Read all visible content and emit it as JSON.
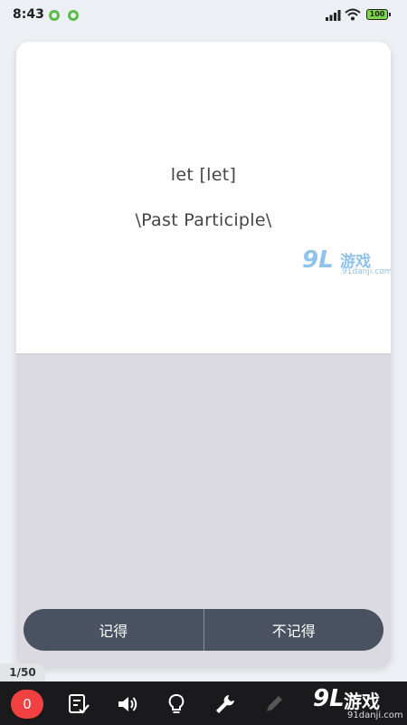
{
  "status_bar": {
    "time": "8:43",
    "battery": "100",
    "accent_green": "#5bbd49"
  },
  "card": {
    "word": "let [let]",
    "form": "\\Past Participle\\"
  },
  "watermark": {
    "logo_big": "9L",
    "logo_cn": "游戏",
    "logo_url": "91danji.com"
  },
  "answers": {
    "remember": "记得",
    "forgot": "不记得"
  },
  "progress": {
    "label": "1/50"
  },
  "toolbar": {
    "score": "0",
    "score_color": "#f04040",
    "icons": [
      "checklist-icon",
      "speaker-icon",
      "lightbulb-icon",
      "wrench-icon",
      "pencil-icon"
    ]
  },
  "footer_logo": {
    "big": "9L",
    "cn": "游戏",
    "url": "91danji.com"
  }
}
